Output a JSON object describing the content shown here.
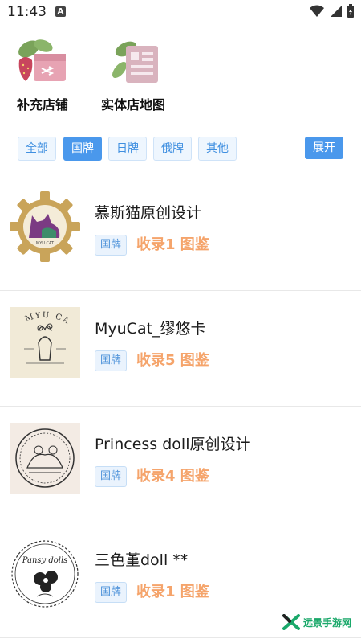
{
  "status_bar": {
    "time": "11:43",
    "notification_badge": "A"
  },
  "shortcuts": [
    {
      "label": "补充店铺",
      "icon": "shop-add-icon"
    },
    {
      "label": "实体店地图",
      "icon": "store-map-icon"
    }
  ],
  "filters": {
    "items": [
      {
        "label": "全部",
        "active": false
      },
      {
        "label": "国牌",
        "active": true
      },
      {
        "label": "日牌",
        "active": false
      },
      {
        "label": "俄牌",
        "active": false
      },
      {
        "label": "其他",
        "active": false
      }
    ],
    "expand_label": "展开"
  },
  "brands": [
    {
      "name": "慕斯猫原创设计",
      "tag": "国牌",
      "count": "收录1 图鉴",
      "logo_text": "MYU CAT"
    },
    {
      "name": "MyuCat_缪悠卡",
      "tag": "国牌",
      "count": "收录5 图鉴",
      "logo_text": "MYU CAT"
    },
    {
      "name": "Princess doll原创设计",
      "tag": "国牌",
      "count": "收录4 图鉴"
    },
    {
      "name": "三色堇doll **",
      "tag": "国牌",
      "count": "收录1 图鉴",
      "logo_text": "Pansy dolls"
    }
  ],
  "watermark": {
    "text": "远景手游网"
  },
  "colors": {
    "accent": "#4a98ec",
    "count": "#f5a46b",
    "tag_text": "#4a90d9"
  }
}
